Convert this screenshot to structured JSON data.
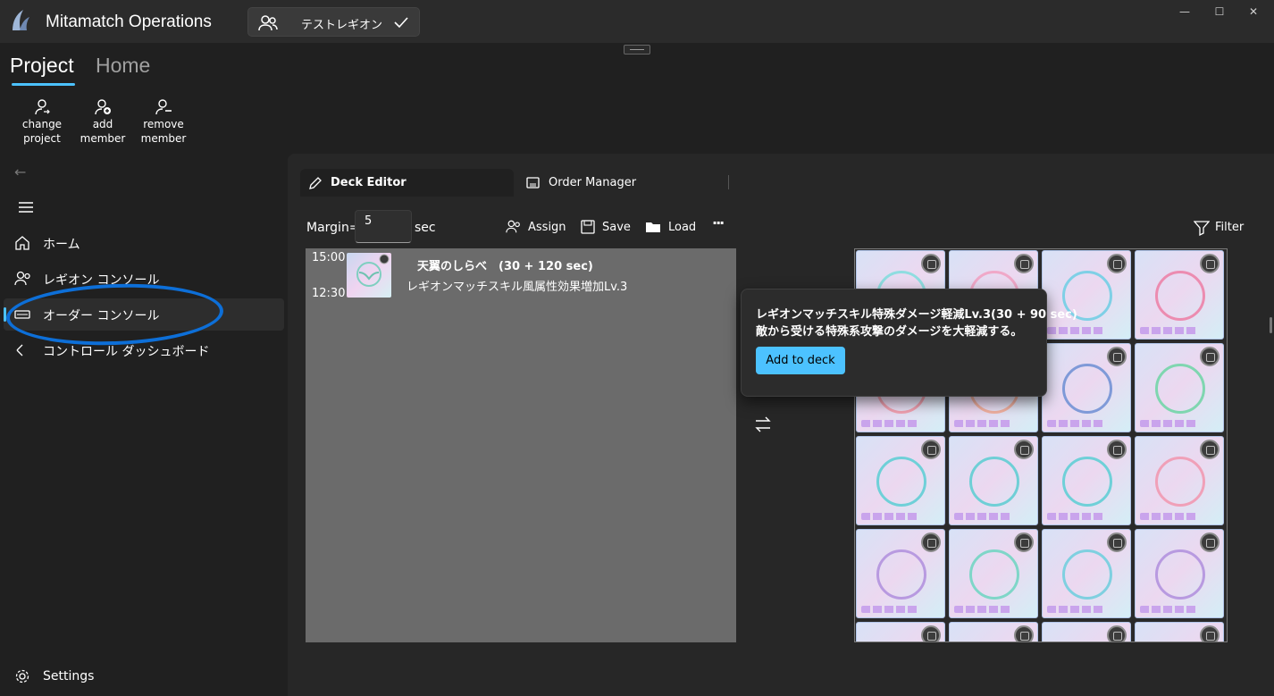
{
  "window": {
    "title": "Mitamatch Operations",
    "legion_name": "テストレギオン",
    "controls": [
      "minimize",
      "maximize",
      "close"
    ]
  },
  "ribbon": {
    "tabs": [
      "Project",
      "Home"
    ],
    "active_tab": "Project",
    "buttons": [
      {
        "line1": "change",
        "line2": "project",
        "icon": "person-swap-icon"
      },
      {
        "line1": "add",
        "line2": "member",
        "icon": "person-add-icon"
      },
      {
        "line1": "remove",
        "line2": "member",
        "icon": "person-remove-icon"
      }
    ]
  },
  "sidebar": {
    "items": [
      {
        "label": "ホーム",
        "icon": "home-icon"
      },
      {
        "label": "レギオン コンソール",
        "icon": "people-icon"
      },
      {
        "label": "オーダー コンソール",
        "icon": "card-icon",
        "selected": true
      },
      {
        "label": "コントロール ダッシュボード",
        "icon": "controls-icon"
      }
    ],
    "settings_label": "Settings"
  },
  "editor": {
    "tabs": [
      {
        "label": "Deck Editor",
        "icon": "pencil-icon",
        "active": true
      },
      {
        "label": "Order Manager",
        "icon": "manager-icon",
        "active": false
      }
    ],
    "margin_label": "Margin=",
    "margin_value": "5",
    "sec_label": "sec",
    "toolbar": {
      "assign": "Assign",
      "save": "Save",
      "load": "Load",
      "more": "···",
      "filter": "Filter"
    }
  },
  "orders": [
    {
      "start": "15:00",
      "end": "12:30",
      "title": "天翼のしらべ　(30 + 120 sec)",
      "description": "レギオンマッチスキル風属性効果増加Lv.3"
    }
  ],
  "tooltip": {
    "title": "レギオンマッチスキル特殊ダメージ軽減Lv.3(30 + 90 sec)",
    "description": "敵から受ける特殊系攻撃のダメージを大軽減する。",
    "button": "Add to deck"
  },
  "colors": {
    "accent": "#4cc2ff",
    "annotation": "#0d6fd8",
    "background": "#202020"
  }
}
